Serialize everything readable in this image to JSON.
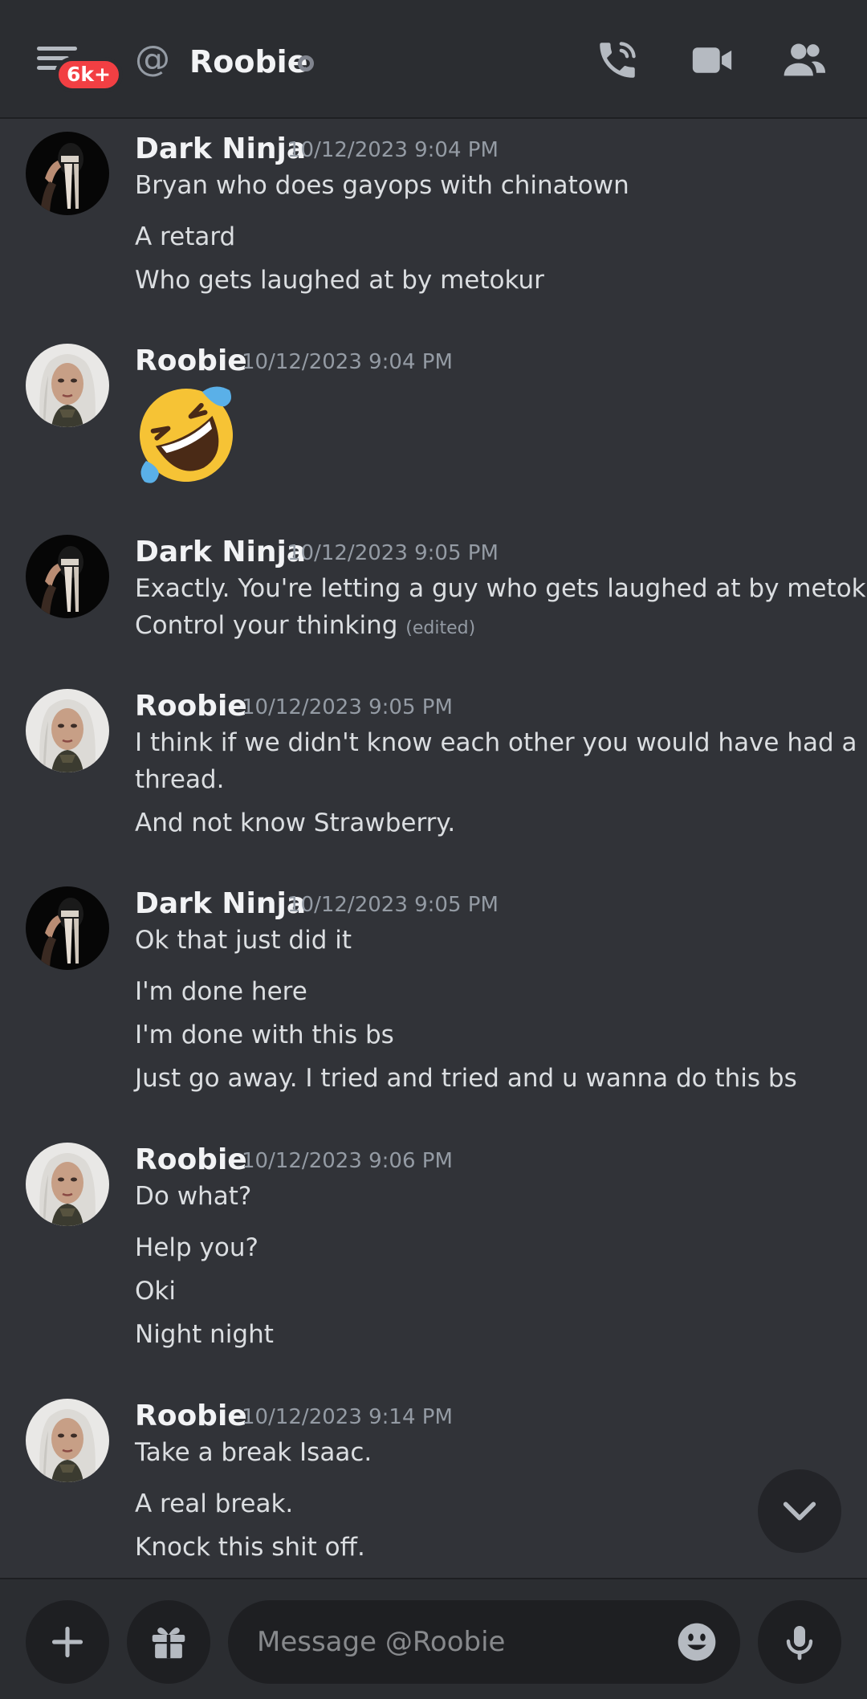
{
  "header": {
    "unread_badge": "6k+",
    "channel_prefix": "@",
    "title": "Roobie",
    "status": "offline",
    "icons": [
      "menu-icon",
      "phone-call-icon",
      "video-call-icon",
      "members-icon"
    ]
  },
  "messages": [
    {
      "author": "Dark Ninja",
      "avatar": "ninja-avatar",
      "time": "10/12/2023 9:04 PM",
      "lines": [
        "Bryan who does gayops with chinatown",
        "A retard",
        "Who gets laughed at by metokur"
      ]
    },
    {
      "author": "Roobie",
      "avatar": "roobie-avatar",
      "time": "10/12/2023 9:04 PM",
      "emoji": "rolling-on-floor-laughing-emoji"
    },
    {
      "author": "Dark Ninja",
      "avatar": "ninja-avatar",
      "time": "10/12/2023 9:05 PM",
      "lines": [
        "Exactly. You're letting a guy who gets laughed at by metokur",
        "Control your thinking"
      ],
      "edited_label": "(edited)"
    },
    {
      "author": "Roobie",
      "avatar": "roobie-avatar",
      "time": "10/12/2023 9:05 PM",
      "lines": [
        "I think if we didn't know each other you would have had a",
        "thread.",
        "And not know Strawberry."
      ]
    },
    {
      "author": "Dark Ninja",
      "avatar": "ninja-avatar",
      "time": "10/12/2023 9:05 PM",
      "lines": [
        "Ok that just did it",
        "I'm done here",
        "I'm done with this bs",
        "Just go away. I tried and tried and u wanna do this bs"
      ]
    },
    {
      "author": "Roobie",
      "avatar": "roobie-avatar",
      "time": "10/12/2023 9:06 PM",
      "lines": [
        "Do what?",
        "Help you?",
        "Oki",
        "Night night"
      ]
    },
    {
      "author": "Roobie",
      "avatar": "roobie-avatar",
      "time": "10/12/2023 9:14 PM",
      "lines": [
        "Take a break Isaac.",
        "A real break.",
        "Knock this shit off."
      ]
    }
  ],
  "composer": {
    "placeholder": "Message @Roobie",
    "value": ""
  },
  "colors": {
    "background": "#313338",
    "header": "#2b2d31",
    "badge": "#f23f43",
    "timestamp": "#949ba4"
  }
}
